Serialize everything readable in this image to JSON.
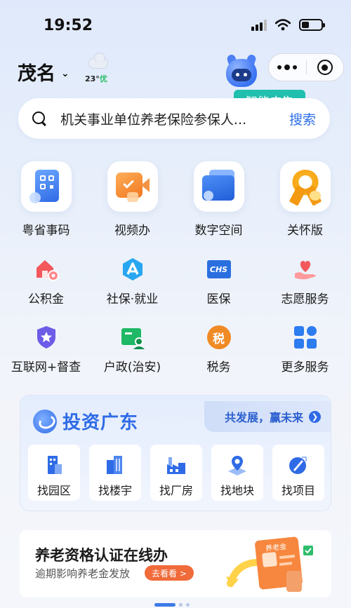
{
  "status": {
    "time": "19:52"
  },
  "header": {
    "city": "茂名",
    "weather_temp": "23°",
    "weather_aqi": "优",
    "ai_badge": "智能广告"
  },
  "search": {
    "text": "机关事业单位养老保险参保人...",
    "button": "搜索"
  },
  "top_services": [
    {
      "label": "粤省事码",
      "icon": "qr-code-card-icon"
    },
    {
      "label": "视频办",
      "icon": "video-camera-icon"
    },
    {
      "label": "数字空间",
      "icon": "digital-space-folder-icon"
    },
    {
      "label": "关怀版",
      "icon": "care-ribbon-icon"
    }
  ],
  "services_row1": [
    {
      "label": "公积金",
      "icon": "house-fund-icon"
    },
    {
      "label": "社保·就业",
      "icon": "social-security-icon"
    },
    {
      "label": "医保",
      "icon": "chs-medical-insurance-icon"
    },
    {
      "label": "志愿服务",
      "icon": "volunteer-heart-hand-icon"
    }
  ],
  "services_row2": [
    {
      "label": "互联网+督查",
      "icon": "shield-star-icon"
    },
    {
      "label": "户政(治安)",
      "icon": "household-registration-icon"
    },
    {
      "label": "税务",
      "icon": "tax-icon"
    },
    {
      "label": "更多服务",
      "icon": "grid-more-icon"
    }
  ],
  "tax_glyph": "税",
  "chs_glyph": "CHS",
  "invest": {
    "title": "投资广东",
    "slogan": "共发展，赢未来",
    "tiles": [
      {
        "label": "找园区",
        "icon": "park-building-icon"
      },
      {
        "label": "找楼宇",
        "icon": "office-tower-icon"
      },
      {
        "label": "找厂房",
        "icon": "factory-icon"
      },
      {
        "label": "找地块",
        "icon": "land-location-pin-icon"
      },
      {
        "label": "找项目",
        "icon": "project-rocket-icon"
      }
    ]
  },
  "pension": {
    "title": "养老资格认证在线办",
    "subtitle": "逾期影响养老金发放",
    "button": "去看看 >",
    "card_text": "养老金"
  },
  "colors": {
    "accent_blue": "#2f6be6",
    "teal_badge": "#20bfae",
    "orange": "#f06a3a"
  }
}
